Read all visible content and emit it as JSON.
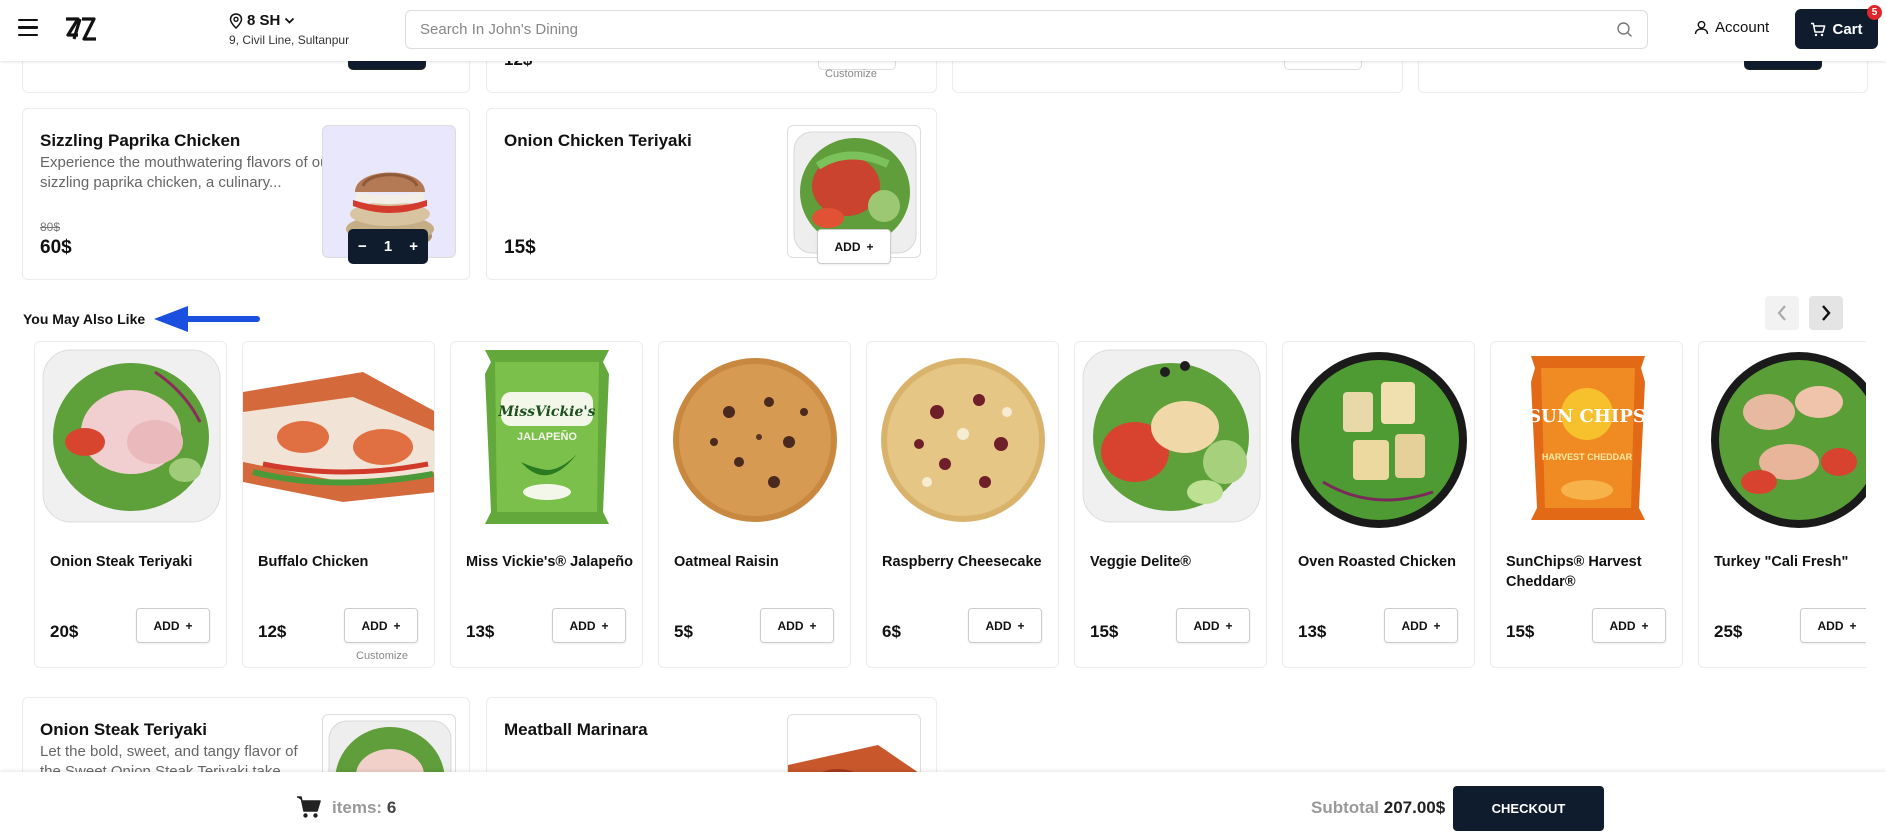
{
  "header": {
    "location_title": "8 SH",
    "location_address": "9, Civil Line, Sultanpur",
    "search_placeholder": "Search In John's Dining",
    "account_label": "Account",
    "cart_label": "Cart",
    "cart_count": "5"
  },
  "top_partial": {
    "price": "12$",
    "customize": "Customize"
  },
  "products": [
    {
      "title": "Sizzling Paprika Chicken",
      "desc": "Experience the mouthwatering flavors of our sizzling paprika chicken, a culinary...",
      "old_price": "80$",
      "price": "60$",
      "qty": "1",
      "minus": "−",
      "plus": "+"
    },
    {
      "title": "Onion Chicken Teriyaki",
      "price": "15$",
      "add_label": "ADD",
      "add_plus": "+"
    }
  ],
  "section": {
    "title": "You May Also Like"
  },
  "recommendations": [
    {
      "name": "Onion Steak Teriyaki",
      "price": "20$",
      "add": "ADD",
      "plus": "+"
    },
    {
      "name": "Buffalo Chicken",
      "price": "12$",
      "add": "ADD",
      "plus": "+",
      "customize": "Customize"
    },
    {
      "name": "Miss Vickie's® Jalapeño",
      "price": "13$",
      "add": "ADD",
      "plus": "+"
    },
    {
      "name": "Oatmeal Raisin",
      "price": "5$",
      "add": "ADD",
      "plus": "+"
    },
    {
      "name": "Raspberry Cheesecake",
      "price": "6$",
      "add": "ADD",
      "plus": "+"
    },
    {
      "name": "Veggie Delite®",
      "price": "15$",
      "add": "ADD",
      "plus": "+"
    },
    {
      "name": "Oven Roasted Chicken",
      "price": "13$",
      "add": "ADD",
      "plus": "+"
    },
    {
      "name": "SunChips® Harvest Cheddar®",
      "price": "15$",
      "add": "ADD",
      "plus": "+"
    },
    {
      "name": "Turkey \"Cali Fresh\"",
      "price": "25$",
      "add": "ADD",
      "plus": "+"
    }
  ],
  "chip_bag_text": {
    "missvickies_brand": "MissVickie's",
    "missvickies_flavor": "JALAPEÑO",
    "sunchips_brand": "SUN CHIPS",
    "sunchips_flavor": "HARVEST CHEDDAR"
  },
  "lower_products": [
    {
      "title": "Onion Steak Teriyaki",
      "desc": "Let the bold, sweet, and tangy flavor of the Sweet Onion Steak Teriyaki take..."
    },
    {
      "title": "Meatball Marinara"
    }
  ],
  "bottom_bar": {
    "items_label": "items:",
    "items_count": "6",
    "subtotal_label": "Subtotal",
    "subtotal_value": "207.00$",
    "checkout_label": "CHECKOUT"
  },
  "colors": {
    "brand_dark": "#0f1c2e",
    "badge_red": "#e0262b",
    "annotation_arrow": "#1a4fe0"
  }
}
